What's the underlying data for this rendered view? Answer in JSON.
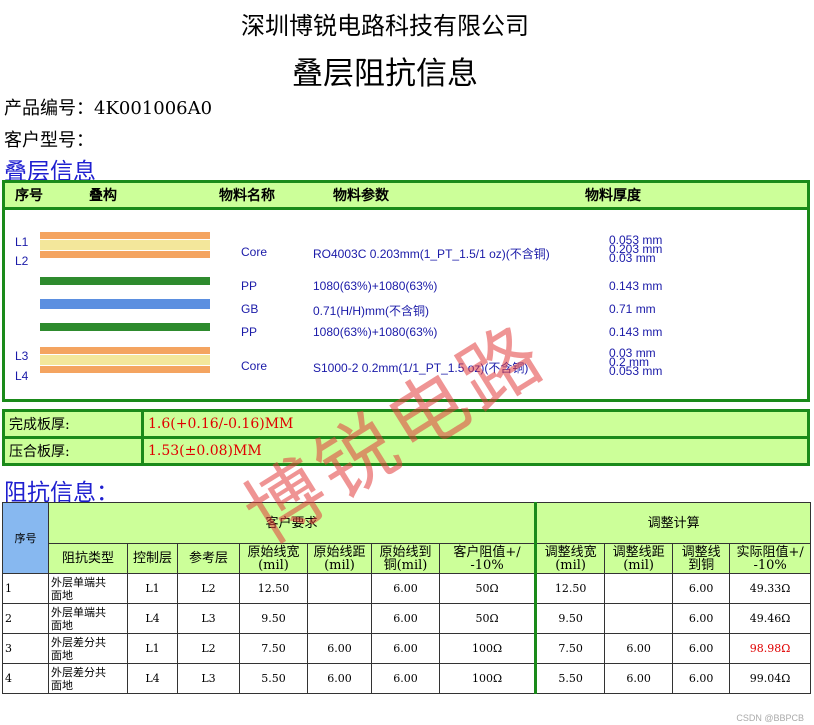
{
  "company": "深圳博锐电路科技有限公司",
  "title": "叠层阻抗信息",
  "product_no": "产品编号：4K001006A0",
  "customer_model": "客户型号：",
  "stack_section": "叠层信息",
  "stack_headers": [
    "序号",
    "叠构",
    "物料名称",
    "物料参数",
    "物料厚度"
  ],
  "layer_labels": [
    "L1",
    "L2",
    "L3",
    "L4"
  ],
  "stack_rows": [
    {
      "name": "Core",
      "param": "RO4003C 0.203mm(1_PT_1.5/1 oz)(不含铜)",
      "thick": [
        "0.053 mm",
        "0.203 mm",
        "0.03 mm"
      ]
    },
    {
      "name": "PP",
      "param": "1080(63%)+1080(63%)",
      "thick": [
        "0.143 mm"
      ]
    },
    {
      "name": "GB",
      "param": "0.71(H/H)mm(不含铜)",
      "thick": [
        "0.71 mm"
      ]
    },
    {
      "name": "PP",
      "param": "1080(63%)+1080(63%)",
      "thick": [
        "0.143 mm"
      ]
    },
    {
      "name": "Core",
      "param": "S1000-2 0.2mm(1/1_PT_1.5 oz)(不含铜)",
      "thick": [
        "0.03 mm",
        "0.2 mm",
        "0.053 mm"
      ]
    }
  ],
  "colors": {
    "copper": "#f4a460",
    "core": "#f3e79b",
    "pp": "#2e8b2e",
    "gb": "#5b8fe0",
    "border": "#1a8a1a",
    "header_bg": "#ccff99",
    "section_blue": "#1f1fd0"
  },
  "finish": {
    "label": "完成板厚:",
    "value": "1.6(+0.16/-0.16)MM"
  },
  "press": {
    "label": "压合板厚:",
    "value": "1.53(±0.08)MM"
  },
  "imp_section": "阻抗信息：",
  "imp_group_headers": {
    "seq": "序号",
    "customer": "客户要求",
    "calc": "调整计算"
  },
  "imp_col_headers": [
    "阻抗类型",
    "控制层",
    "参考层",
    "原始线宽\n(mil)",
    "原始线距\n(mil)",
    "原始线到\n铜(mil)",
    "客户阻值+/\n-10%",
    "调整线宽\n(mil)",
    "调整线距\n(mil)",
    "调整线\n到铜",
    "实际阻值+/\n-10%"
  ],
  "imp_rows": [
    [
      "1",
      "外层单端共\n面地",
      "L1",
      "L2",
      "12.50",
      "",
      "6.00",
      "50Ω",
      "12.50",
      "",
      "6.00",
      "49.33Ω"
    ],
    [
      "2",
      "外层单端共\n面地",
      "L4",
      "L3",
      "9.50",
      "",
      "6.00",
      "50Ω",
      "9.50",
      "",
      "6.00",
      "49.46Ω"
    ],
    [
      "3",
      "外层差分共\n面地",
      "L1",
      "L2",
      "7.50",
      "6.00",
      "6.00",
      "100Ω",
      "7.50",
      "6.00",
      "6.00",
      "98.98Ω"
    ],
    [
      "4",
      "外层差分共\n面地",
      "L4",
      "L3",
      "5.50",
      "6.00",
      "6.00",
      "100Ω",
      "5.50",
      "6.00",
      "6.00",
      "99.04Ω"
    ]
  ],
  "watermark": "博锐电路",
  "credit": "CSDN @BBPCB"
}
